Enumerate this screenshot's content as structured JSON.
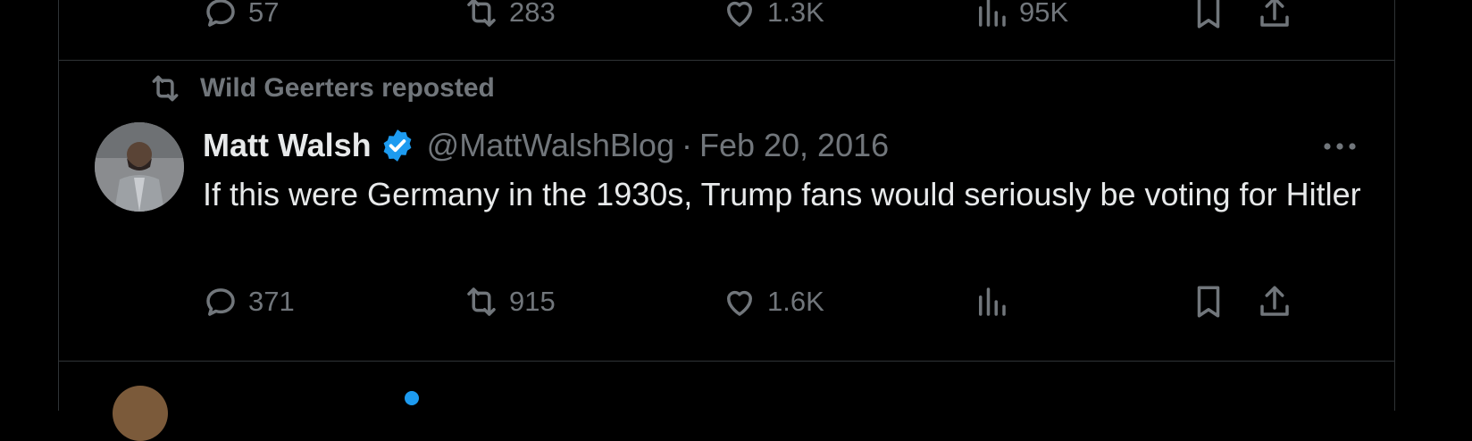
{
  "prev_tweet": {
    "actions": {
      "reply_count": "57",
      "repost_count": "283",
      "like_count": "1.3K",
      "views_count": "95K"
    }
  },
  "tweet": {
    "repost_label": "Wild Geerters reposted",
    "author_name": "Matt Walsh",
    "handle": "@MattWalshBlog",
    "separator": "·",
    "date": "Feb 20, 2016",
    "text": "If this were Germany in the 1930s, Trump fans would seriously be voting for Hitler",
    "actions": {
      "reply_count": "371",
      "repost_count": "915",
      "like_count": "1.6K",
      "views_count": ""
    }
  },
  "icons": {
    "reply": "speech-bubble-icon",
    "repost": "repost-arrows-icon",
    "like": "heart-icon",
    "views": "bar-chart-icon",
    "bookmark": "bookmark-icon",
    "share": "share-icon",
    "verified": "verified-badge-icon",
    "more": "more-dots-icon"
  },
  "colors": {
    "background": "#000000",
    "text_primary": "#e7e9ea",
    "text_secondary": "#71767b",
    "divider": "#2f3336",
    "verified_blue": "#1d9bf0"
  }
}
